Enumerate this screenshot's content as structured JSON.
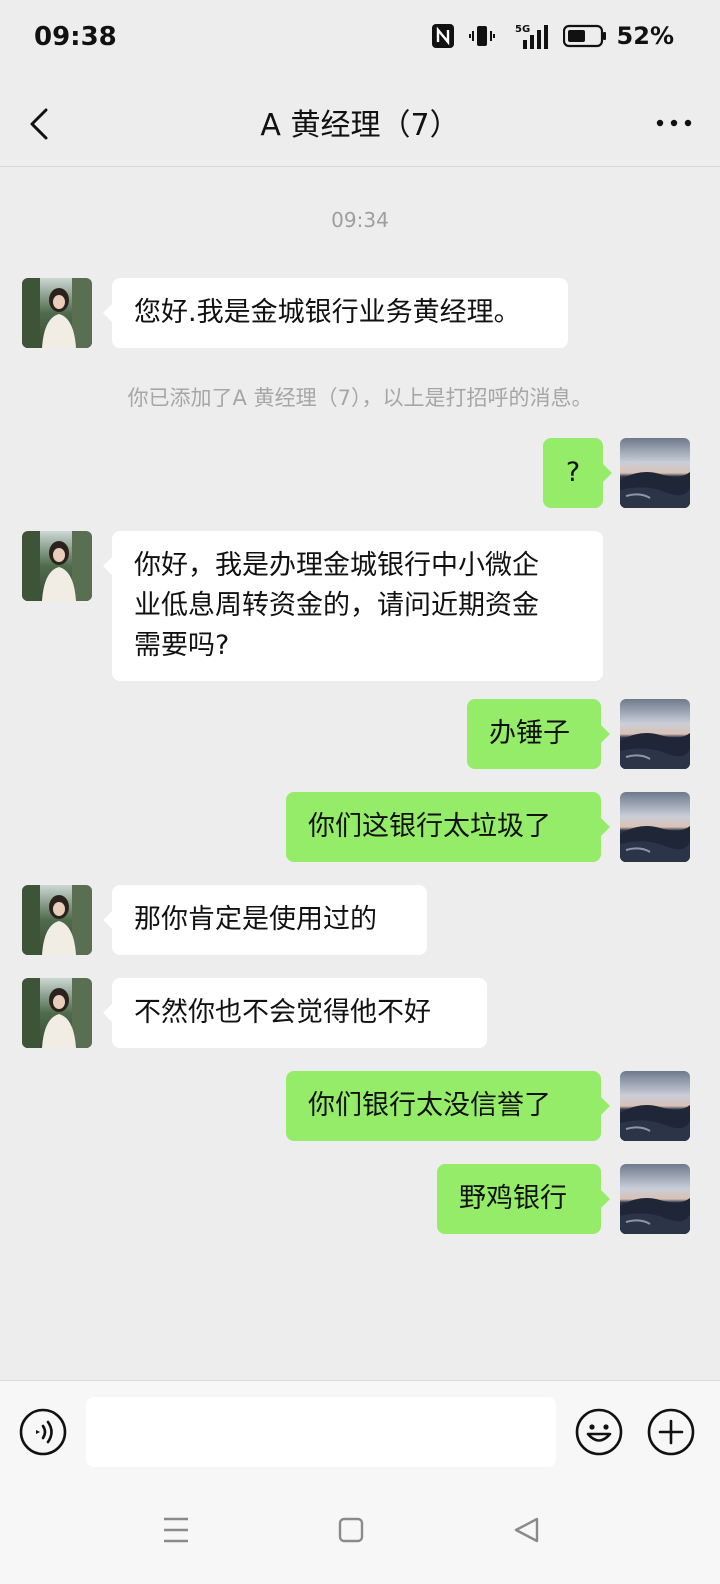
{
  "status_bar": {
    "time": "09:38",
    "network": "5G",
    "battery": "52%"
  },
  "header": {
    "title": "A  黄经理（7）"
  },
  "chat": {
    "timestamp": "09:34",
    "system_note": "你已添加了A  黄经理（7），以上是打招呼的消息。",
    "messages": [
      {
        "sender": "other",
        "text": "您好.我是金城银行业务黄经理。"
      },
      {
        "sender": "me",
        "text": "?"
      },
      {
        "sender": "other",
        "lines": [
          "你好，我是办理金城银行中小微企",
          "业低息周转资金的，请问近期资金",
          "需要吗?"
        ]
      },
      {
        "sender": "me",
        "text": "办锤子"
      },
      {
        "sender": "me",
        "text": "你们这银行太垃圾了"
      },
      {
        "sender": "other",
        "text": "那你肯定是使用过的"
      },
      {
        "sender": "other",
        "text": "不然你也不会觉得他不好"
      },
      {
        "sender": "me",
        "text": "你们银行太没信誉了"
      },
      {
        "sender": "me",
        "text": "野鸡银行"
      }
    ]
  },
  "input": {
    "value": "",
    "placeholder": ""
  },
  "icons": {
    "back": "chevron-left-icon",
    "more": "more-dots-icon",
    "voice": "voice-icon",
    "emoji": "emoji-icon",
    "plus": "plus-icon",
    "nav_menu": "menu-icon",
    "nav_home": "home-icon",
    "nav_back": "back-triangle-icon"
  },
  "colors": {
    "my_bubble": "#95ec69",
    "other_bubble": "#ffffff",
    "background": "#ededed"
  }
}
